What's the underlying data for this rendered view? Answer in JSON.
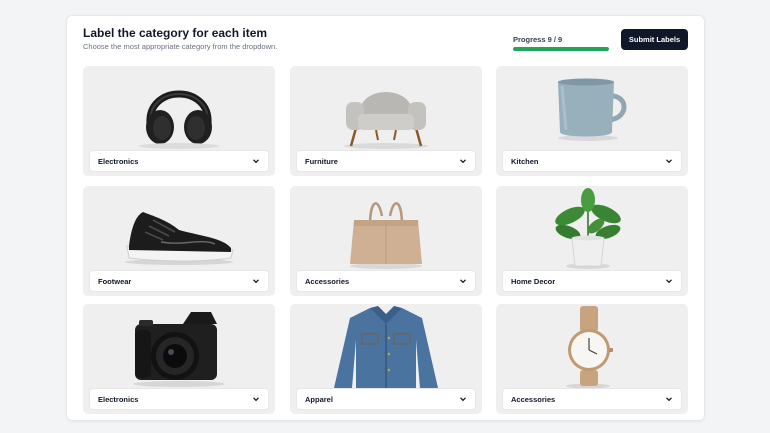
{
  "header": {
    "title": "Label the category for each item",
    "subtitle": "Choose the most appropriate category from the dropdown."
  },
  "progress": {
    "label": "Progress 9 / 9",
    "done": 9,
    "total": 9,
    "fraction": 1.0
  },
  "actions": {
    "submit_label": "Submit Labels"
  },
  "colors": {
    "accent": "#0f1729",
    "progress": "#22a559",
    "panel": "#ffffff",
    "background": "#f3f4f6"
  },
  "items": [
    {
      "icon": "headphones-icon",
      "category": "Electronics"
    },
    {
      "icon": "armchair-icon",
      "category": "Furniture"
    },
    {
      "icon": "mug-icon",
      "category": "Kitchen"
    },
    {
      "icon": "sneaker-icon",
      "category": "Footwear"
    },
    {
      "icon": "handbag-icon",
      "category": "Accessories"
    },
    {
      "icon": "potted-plant-icon",
      "category": "Home Decor"
    },
    {
      "icon": "camera-icon",
      "category": "Electronics"
    },
    {
      "icon": "denim-jacket-icon",
      "category": "Apparel"
    },
    {
      "icon": "wristwatch-icon",
      "category": "Accessories"
    }
  ]
}
